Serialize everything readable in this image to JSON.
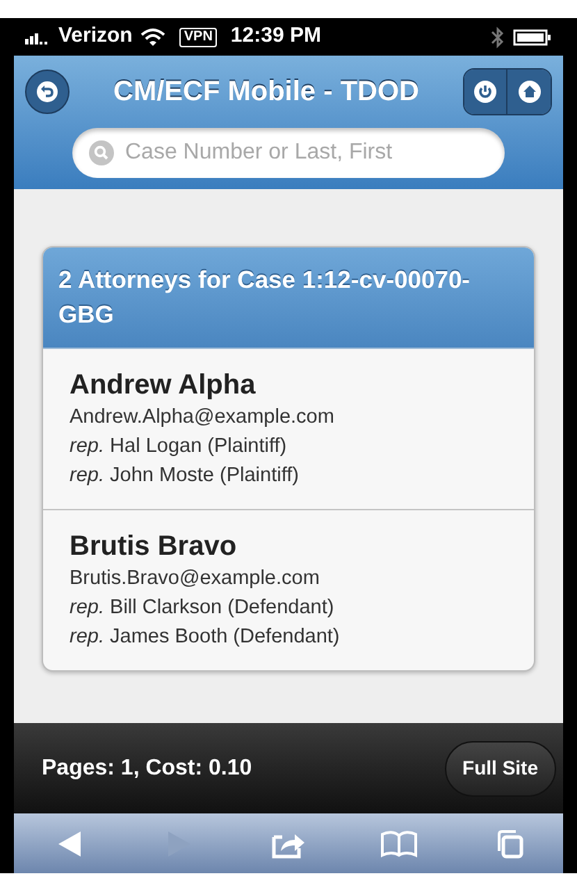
{
  "status_bar": {
    "carrier": "Verizon",
    "vpn": "VPN",
    "time": "12:39 PM"
  },
  "header": {
    "title": "CM/ECF Mobile - TDOD"
  },
  "search": {
    "placeholder": "Case Number or Last, First"
  },
  "card": {
    "title": "2 Attorneys for Case 1:12-cv-00070-GBG",
    "attorneys": [
      {
        "name": "Andrew Alpha",
        "email": "Andrew.Alpha@example.com",
        "represents": [
          "*rep.* Hal Logan (Plaintiff)",
          "*rep.* John Moste (Plaintiff)"
        ]
      },
      {
        "name": "Brutis Bravo",
        "email": "Brutis.Bravo@example.com",
        "represents": [
          "*rep.* Bill Clarkson (Defendant)",
          "*rep.* James Booth (Defendant)"
        ]
      }
    ]
  },
  "footer": {
    "summary": "Pages: 1, Cost: 0.10",
    "button": "Full Site"
  },
  "browser_toolbar": [
    {
      "kind": "back",
      "disabled": false
    },
    {
      "kind": "forward",
      "disabled": true
    },
    {
      "kind": "share",
      "disabled": false
    },
    {
      "kind": "bookmarks",
      "disabled": false
    },
    {
      "kind": "tabs",
      "disabled": false
    }
  ]
}
